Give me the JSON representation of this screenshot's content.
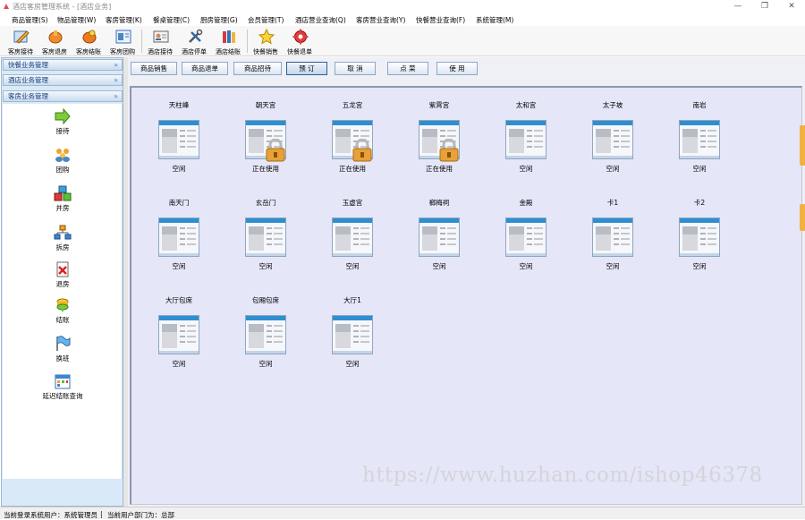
{
  "window": {
    "title": "酒店客房管理系统 - [酒店业务]",
    "controls": {
      "minimize": "—",
      "restore": "❐",
      "close": "✕"
    }
  },
  "menu": [
    "商品管理(S)",
    "物品管理(W)",
    "客房管理(K)",
    "餐桌管理(C)",
    "厨房管理(G)",
    "会员管理(T)",
    "酒店营业查询(Q)",
    "客房营业查询(Y)",
    "快餐营业查询(F)",
    "系统管理(M)"
  ],
  "toolbar": [
    {
      "label": "客房接待",
      "icon": "pencil-icon"
    },
    {
      "label": "客房退房",
      "icon": "hand-back-icon"
    },
    {
      "label": "客房结账",
      "icon": "hand-pay-icon"
    },
    {
      "label": "客房团购",
      "icon": "group-card-icon"
    },
    {
      "label": "酒店接待",
      "icon": "id-card-icon"
    },
    {
      "label": "酒店停单",
      "icon": "tools-icon"
    },
    {
      "label": "酒店结账",
      "icon": "books-icon"
    },
    {
      "label": "快餐销售",
      "icon": "star-icon"
    },
    {
      "label": "快餐退单",
      "icon": "gear-icon"
    }
  ],
  "sidebar": {
    "panels": [
      "快餐业务管理",
      "酒店业务管理",
      "客房业务管理"
    ],
    "chevron": "»",
    "items": [
      {
        "label": "接待",
        "icon": "arrow-right-icon"
      },
      {
        "label": "团购",
        "icon": "people-icon"
      },
      {
        "label": "并房",
        "icon": "cubes-icon"
      },
      {
        "label": "拆房",
        "icon": "org-chart-icon"
      },
      {
        "label": "退房",
        "icon": "document-delete-icon"
      },
      {
        "label": "结账",
        "icon": "coins-icon"
      },
      {
        "label": "换班",
        "icon": "flag-icon"
      },
      {
        "label": "延迟结账查询",
        "icon": "calendar-icon"
      }
    ]
  },
  "actions": [
    "商品销售",
    "商品退单",
    "商品招待",
    "预 订",
    "取 消",
    "点 菜",
    "使 用"
  ],
  "rooms": [
    {
      "name": "天柱峰",
      "status": "空闲",
      "locked": false
    },
    {
      "name": "朝天宫",
      "status": "正在使用",
      "locked": true
    },
    {
      "name": "五龙宫",
      "status": "正在使用",
      "locked": true
    },
    {
      "name": "紫霄宫",
      "status": "正在使用",
      "locked": true
    },
    {
      "name": "太和宫",
      "status": "空闲",
      "locked": false
    },
    {
      "name": "太子坡",
      "status": "空闲",
      "locked": false
    },
    {
      "name": "南岩",
      "status": "空闲",
      "locked": false
    },
    {
      "name": "南天门",
      "status": "空闲",
      "locked": false
    },
    {
      "name": "玄岳门",
      "status": "空闲",
      "locked": false
    },
    {
      "name": "玉虚宫",
      "status": "空闲",
      "locked": false
    },
    {
      "name": "榔梅祠",
      "status": "空闲",
      "locked": false
    },
    {
      "name": "金殿",
      "status": "空闲",
      "locked": false
    },
    {
      "name": "卡1",
      "status": "空闲",
      "locked": false
    },
    {
      "name": "卡2",
      "status": "空闲",
      "locked": false
    },
    {
      "name": "大厅包席",
      "status": "空闲",
      "locked": false
    },
    {
      "name": "包厢包席",
      "status": "空闲",
      "locked": false
    },
    {
      "name": "大厅1",
      "status": "空闲",
      "locked": false
    }
  ],
  "watermark": "https://www.huzhan.com/ishop46378",
  "statusbar": {
    "user": "当前登录系统用户：系统管理员",
    "dept": "当前用户部门为：总部"
  },
  "colors": {
    "sidebar": "#d9e9f8",
    "room_area": "#e5e6f8",
    "window_icon_bar": "#2e8fd0",
    "lock": "#e8a13a",
    "accent_tab": "#f2b13e"
  }
}
